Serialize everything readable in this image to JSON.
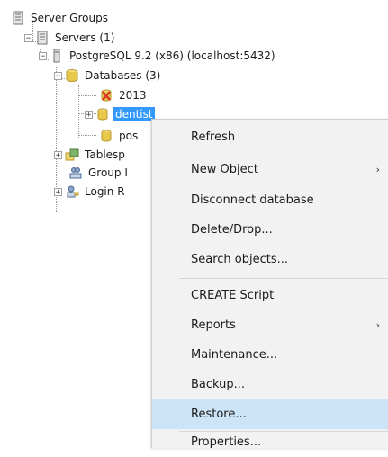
{
  "tree": {
    "server_groups": "Server Groups",
    "servers": "Servers (1)",
    "postgres_server": "PostgreSQL 9.2 (x86) (localhost:5432)",
    "databases": "Databases (3)",
    "db_2013": "2013",
    "db_dentist": "dentist",
    "db_postgres": "pos",
    "tablespaces": "Tablesp",
    "group_roles": "Group I",
    "login_roles": "Login R"
  },
  "context_menu": {
    "refresh": "Refresh",
    "new_object": "New Object",
    "disconnect": "Disconnect database",
    "delete_drop": "Delete/Drop...",
    "search_objects": "Search objects...",
    "create_script": "CREATE Script",
    "reports": "Reports",
    "maintenance": "Maintenance...",
    "backup": "Backup...",
    "restore": "Restore...",
    "properties": "Properties...",
    "submenu_arrow": "›"
  },
  "colors": {
    "selection": "#3399ff",
    "menu_highlight": "#cce4f7",
    "menu_bg": "#f2f2f2",
    "error_red": "#d83a2c",
    "db_yellow": "#e8c84a"
  }
}
